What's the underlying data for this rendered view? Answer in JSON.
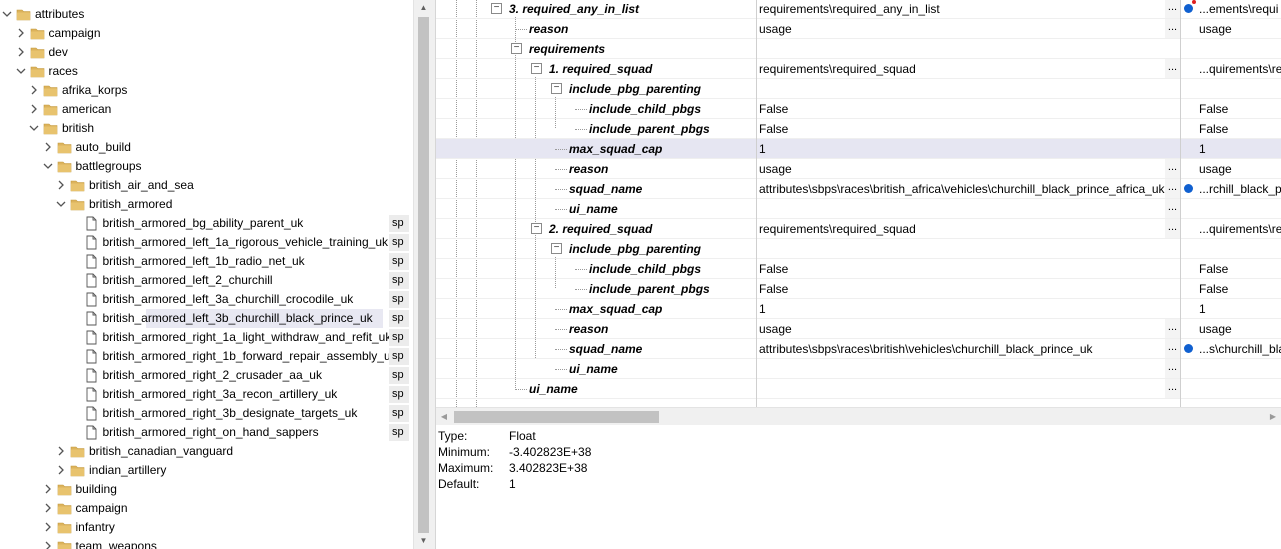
{
  "tree": {
    "rows": [
      {
        "label": "attributes",
        "indent": 0,
        "expanded": true,
        "folder": true
      },
      {
        "label": "campaign",
        "indent": 1,
        "expanded": false,
        "folder": true
      },
      {
        "label": "dev",
        "indent": 1,
        "expanded": false,
        "folder": true
      },
      {
        "label": "races",
        "indent": 1,
        "expanded": true,
        "folder": true
      },
      {
        "label": "afrika_korps",
        "indent": 2,
        "expanded": false,
        "folder": true
      },
      {
        "label": "american",
        "indent": 2,
        "expanded": false,
        "folder": true
      },
      {
        "label": "british",
        "indent": 2,
        "expanded": true,
        "folder": true
      },
      {
        "label": "auto_build",
        "indent": 3,
        "expanded": false,
        "folder": true
      },
      {
        "label": "battlegroups",
        "indent": 3,
        "expanded": true,
        "folder": true
      },
      {
        "label": "british_air_and_sea",
        "indent": 4,
        "expanded": false,
        "folder": true
      },
      {
        "label": "british_armored",
        "indent": 4,
        "expanded": true,
        "folder": true
      },
      {
        "label": "british_armored_bg_ability_parent_uk",
        "indent": 5,
        "folder": false,
        "tag": "sp"
      },
      {
        "label": "british_armored_left_1a_rigorous_vehicle_training_uk",
        "indent": 5,
        "folder": false,
        "tag": "sp"
      },
      {
        "label": "british_armored_left_1b_radio_net_uk",
        "indent": 5,
        "folder": false,
        "tag": "sp"
      },
      {
        "label": "british_armored_left_2_churchill",
        "indent": 5,
        "folder": false,
        "tag": "sp"
      },
      {
        "label": "british_armored_left_3a_churchill_crocodile_uk",
        "indent": 5,
        "folder": false,
        "tag": "sp"
      },
      {
        "label": "british_armored_left_3b_churchill_black_prince_uk",
        "indent": 5,
        "folder": false,
        "tag": "sp",
        "selected": true
      },
      {
        "label": "british_armored_right_1a_light_withdraw_and_refit_uk",
        "indent": 5,
        "folder": false,
        "tag": "sp"
      },
      {
        "label": "british_armored_right_1b_forward_repair_assembly_uk",
        "indent": 5,
        "folder": false,
        "tag": "sp"
      },
      {
        "label": "british_armored_right_2_crusader_aa_uk",
        "indent": 5,
        "folder": false,
        "tag": "sp"
      },
      {
        "label": "british_armored_right_3a_recon_artillery_uk",
        "indent": 5,
        "folder": false,
        "tag": "sp"
      },
      {
        "label": "british_armored_right_3b_designate_targets_uk",
        "indent": 5,
        "folder": false,
        "tag": "sp"
      },
      {
        "label": "british_armored_right_on_hand_sappers",
        "indent": 5,
        "folder": false,
        "tag": "sp"
      },
      {
        "label": "british_canadian_vanguard",
        "indent": 4,
        "expanded": false,
        "folder": true
      },
      {
        "label": "indian_artillery",
        "indent": 4,
        "expanded": false,
        "folder": true
      },
      {
        "label": "building",
        "indent": 3,
        "expanded": false,
        "folder": true
      },
      {
        "label": "campaign",
        "indent": 3,
        "expanded": false,
        "folder": true
      },
      {
        "label": "infantry",
        "indent": 3,
        "expanded": false,
        "folder": true
      },
      {
        "label": "team_weapons",
        "indent": 3,
        "expanded": false,
        "folder": true
      }
    ]
  },
  "grid": {
    "rows": [
      {
        "name": "3. required_any_in_list",
        "depth": 0,
        "toggle": "minus",
        "value": "requirements\\required_any_in_list",
        "ellipsis": true,
        "compare": "...ements\\requi",
        "dot": true,
        "reddot": true
      },
      {
        "name": "reason",
        "depth": 1,
        "value": "usage",
        "ellipsis": true,
        "compare": "usage"
      },
      {
        "name": "requirements",
        "depth": 1,
        "toggle": "minus",
        "value": "",
        "compare": ""
      },
      {
        "name": "1. required_squad",
        "depth": 2,
        "toggle": "minus",
        "value": "requirements\\required_squad",
        "ellipsis": true,
        "compare": "...quirements\\re"
      },
      {
        "name": "include_pbg_parenting",
        "depth": 3,
        "toggle": "minus",
        "value": "",
        "compare": ""
      },
      {
        "name": "include_child_pbgs",
        "depth": 4,
        "value": "False",
        "compare": "False"
      },
      {
        "name": "include_parent_pbgs",
        "depth": 4,
        "value": "False",
        "compare": "False"
      },
      {
        "name": "max_squad_cap",
        "depth": 3,
        "value": "1",
        "compare": "1",
        "highlight": true
      },
      {
        "name": "reason",
        "depth": 3,
        "value": "usage",
        "ellipsis": true,
        "compare": "usage"
      },
      {
        "name": "squad_name",
        "depth": 3,
        "value": "attributes\\sbps\\races\\british_africa\\vehicles\\churchill_black_prince_africa_uk",
        "ellipsis": true,
        "compare": "...rchill_black_p",
        "dot": true
      },
      {
        "name": "ui_name",
        "depth": 3,
        "value": "",
        "ellipsis": true,
        "compare": ""
      },
      {
        "name": "2. required_squad",
        "depth": 2,
        "toggle": "minus",
        "value": "requirements\\required_squad",
        "ellipsis": true,
        "compare": "...quirements\\re"
      },
      {
        "name": "include_pbg_parenting",
        "depth": 3,
        "toggle": "minus",
        "value": "",
        "compare": ""
      },
      {
        "name": "include_child_pbgs",
        "depth": 4,
        "value": "False",
        "compare": "False"
      },
      {
        "name": "include_parent_pbgs",
        "depth": 4,
        "value": "False",
        "compare": "False"
      },
      {
        "name": "max_squad_cap",
        "depth": 3,
        "value": "1",
        "compare": "1"
      },
      {
        "name": "reason",
        "depth": 3,
        "value": "usage",
        "ellipsis": true,
        "compare": "usage"
      },
      {
        "name": "squad_name",
        "depth": 3,
        "value": "attributes\\sbps\\races\\british\\vehicles\\churchill_black_prince_uk",
        "ellipsis": true,
        "compare": "...s\\churchill_bla",
        "dot": true
      },
      {
        "name": "ui_name",
        "depth": 3,
        "value": "",
        "ellipsis": true,
        "compare": ""
      },
      {
        "name": "ui_name",
        "depth": 1,
        "value": "",
        "ellipsis": true,
        "compare": ""
      }
    ],
    "ellipsis_label": "..."
  },
  "info": {
    "type_label": "Type:",
    "type_value": "Float",
    "min_label": "Minimum:",
    "min_value": "-3.402823E+38",
    "max_label": "Maximum:",
    "max_value": "3.402823E+38",
    "default_label": "Default:",
    "default_value": "1"
  },
  "colors": {
    "selection": "#e8e8f2",
    "highlight": "#e6e6f2",
    "dot": "#1060d0",
    "folder": "#dcb35c"
  }
}
